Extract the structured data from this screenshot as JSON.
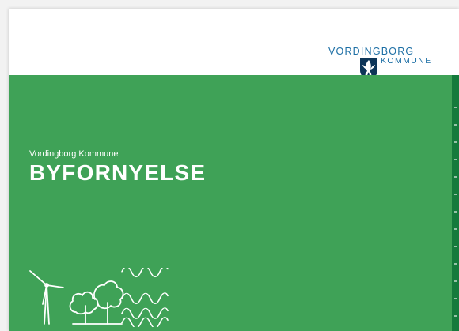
{
  "document": {
    "logo": {
      "line1": "VORDINGBORG",
      "line2": "KOMMUNE",
      "icon": "municipal-shield-icon"
    },
    "cover": {
      "subtitle": "Vordingborg Kommune",
      "title": "BYFORNYELSE",
      "illustration_icons": [
        "wind-turbine-icon",
        "trees-icon",
        "waves-icon"
      ]
    }
  },
  "colors": {
    "green": "#3fa257",
    "dark_green": "#157a3c",
    "logo_blue": "#1d6fa5",
    "logo_navy": "#0d3558"
  }
}
